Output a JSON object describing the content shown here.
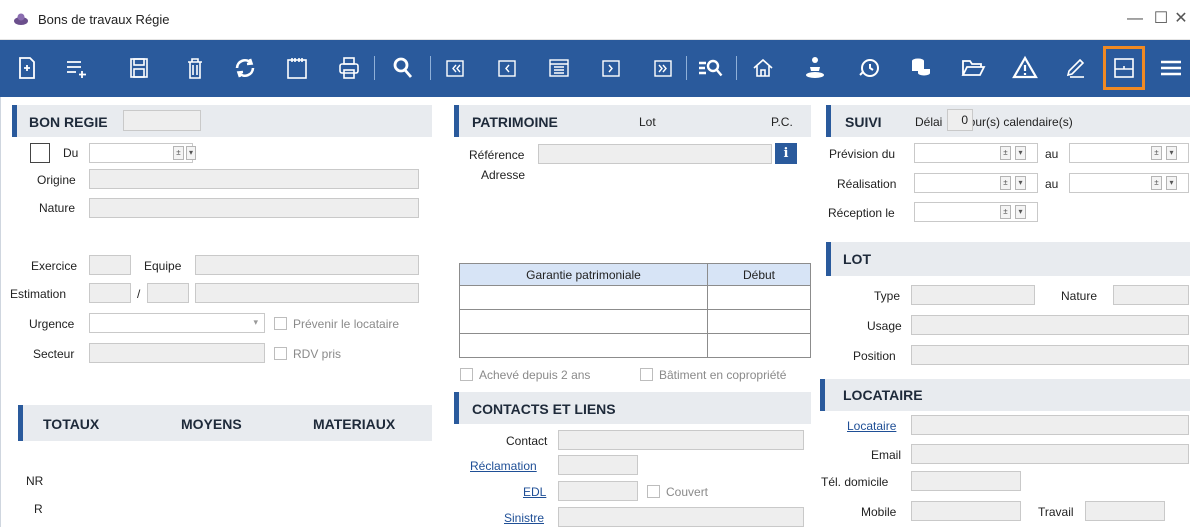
{
  "window": {
    "title": "Bons de travaux Régie",
    "minimize": "—",
    "maximize": "☐",
    "close": "✕"
  },
  "toolbar": {
    "icons": [
      "new-doc-icon",
      "add-list-icon",
      "save-icon",
      "delete-icon",
      "refresh-icon",
      "calendar-icon",
      "print-icon",
      "search-icon",
      "first-record-icon",
      "previous-record-icon",
      "list-view-icon",
      "next-record-icon",
      "last-record-icon",
      "filter-search-icon",
      "home-icon",
      "user-icon",
      "history-icon",
      "database-icon",
      "folder-open-icon",
      "warning-icon",
      "attach-icon",
      "layout-icon",
      "menu-icon"
    ],
    "highlight_color": "#f08a24",
    "background": "#2a5a9c"
  },
  "bon_regie": {
    "header": "BON REGIE",
    "du_label": "Du",
    "origine_label": "Origine",
    "nature_label": "Nature",
    "exercice_label": "Exercice",
    "equipe_label": "Equipe",
    "estimation_label": "Estimation",
    "estimation_sep": "/",
    "urgence_label": "Urgence",
    "prevenir_label": "Prévenir le locataire",
    "secteur_label": "Secteur",
    "rdv_label": "RDV pris"
  },
  "totaux": {
    "header": "TOTAUX",
    "moyens": "MOYENS",
    "materiaux": "MATERIAUX",
    "nr_label": "NR",
    "r_label": "R"
  },
  "patrimoine": {
    "header": "PATRIMOINE",
    "lot": "Lot",
    "pc": "P.C.",
    "reference_label": "Référence",
    "adresse_label": "Adresse",
    "info_button": "i",
    "table_headers": [
      "Garantie patrimoniale",
      "Début"
    ],
    "acheve_label": "Achevé depuis 2 ans",
    "batiment_label": "Bâtiment en copropriété"
  },
  "contacts": {
    "header": "CONTACTS ET LIENS",
    "contact_label": "Contact",
    "reclamation_label": "Réclamation",
    "edl_label": "EDL",
    "couvert_label": "Couvert",
    "sinistre_label": "Sinistre"
  },
  "suivi": {
    "header": "SUIVI",
    "delai_label": "Délai",
    "delai_value": "0",
    "delai_unit": "jour(s) calendaire(s)",
    "prevision_label": "Prévision du",
    "realisation_label": "Réalisation",
    "reception_label": "Réception le",
    "au_label": "au"
  },
  "lot": {
    "header": "LOT",
    "type_label": "Type",
    "nature_label": "Nature",
    "usage_label": "Usage",
    "position_label": "Position"
  },
  "locataire": {
    "header": "LOCATAIRE",
    "locataire_label": "Locataire",
    "email_label": "Email",
    "tel_label": "Tél. domicile",
    "mobile_label": "Mobile",
    "travail_label": "Travail"
  }
}
